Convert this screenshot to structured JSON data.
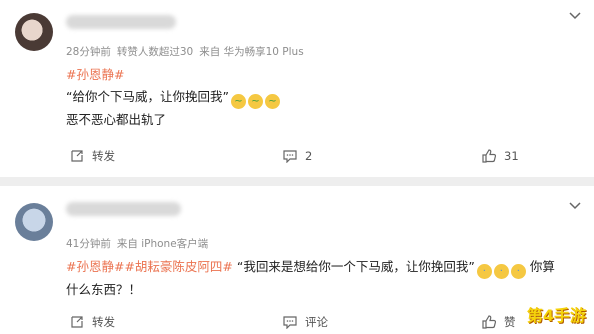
{
  "posts": [
    {
      "meta": {
        "time": "28分钟前",
        "reposts": "转赞人数超过30",
        "source": "来自 华为畅享10 Plus"
      },
      "topics": [
        "#孙恩静#"
      ],
      "lines": [
        "“给你个下马威，让你挽回我”",
        "恶不恶心都出轨了"
      ],
      "actions": {
        "repost": "转发",
        "comment": "2",
        "like": "31"
      }
    },
    {
      "meta": {
        "time": "41分钟前",
        "source": "来自 iPhone客户端"
      },
      "topics": [
        "#孙恩静#",
        "#胡耘豪陈皮阿四#"
      ],
      "text": "“我回来是想给你一个下马威，让你挽回我”",
      "text_tail": "你算",
      "line2": "什么东西？！",
      "actions": {
        "repost": "转发",
        "comment": "评论",
        "like": "赞"
      }
    }
  ],
  "icons": [
    "chevron-down-icon",
    "repost-icon",
    "comment-icon",
    "like-icon",
    "vomit-emoji-icon",
    "sweat-emoji-icon"
  ],
  "colors": {
    "topic": "#eb7350",
    "meta": "#8e8e8e",
    "separator": "#eeeeee"
  },
  "watermark": "第4手游"
}
